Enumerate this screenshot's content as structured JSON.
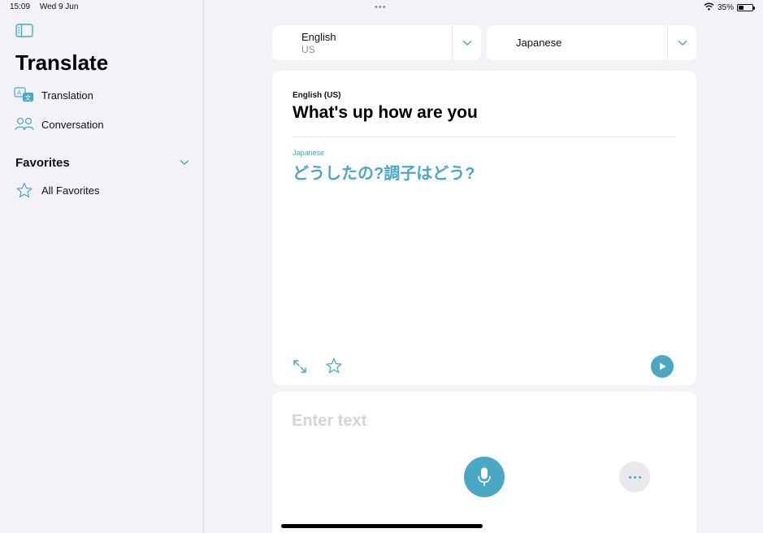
{
  "status_bar": {
    "time": "15:09",
    "date": "Wed 9 Jun",
    "battery": "35%",
    "battery_level": 0.35
  },
  "sidebar": {
    "title": "Translate",
    "items": [
      {
        "label": "Translation",
        "icon": "translation-icon"
      },
      {
        "label": "Conversation",
        "icon": "people-icon"
      }
    ],
    "favorites": {
      "title": "Favorites",
      "items": [
        {
          "label": "All Favorites",
          "icon": "star-icon"
        }
      ]
    }
  },
  "languages": {
    "source": {
      "name": "English",
      "region": "US"
    },
    "target": {
      "name": "Japanese"
    }
  },
  "translation": {
    "source_label": "English (US)",
    "source_text": "What's up how are you",
    "target_label": "Japanese",
    "target_text": "どうしたの?調子はどう?"
  },
  "input": {
    "placeholder": "Enter text"
  },
  "colors": {
    "accent": "#4aa8c4",
    "background": "#f2f2f7",
    "card": "#ffffff"
  }
}
